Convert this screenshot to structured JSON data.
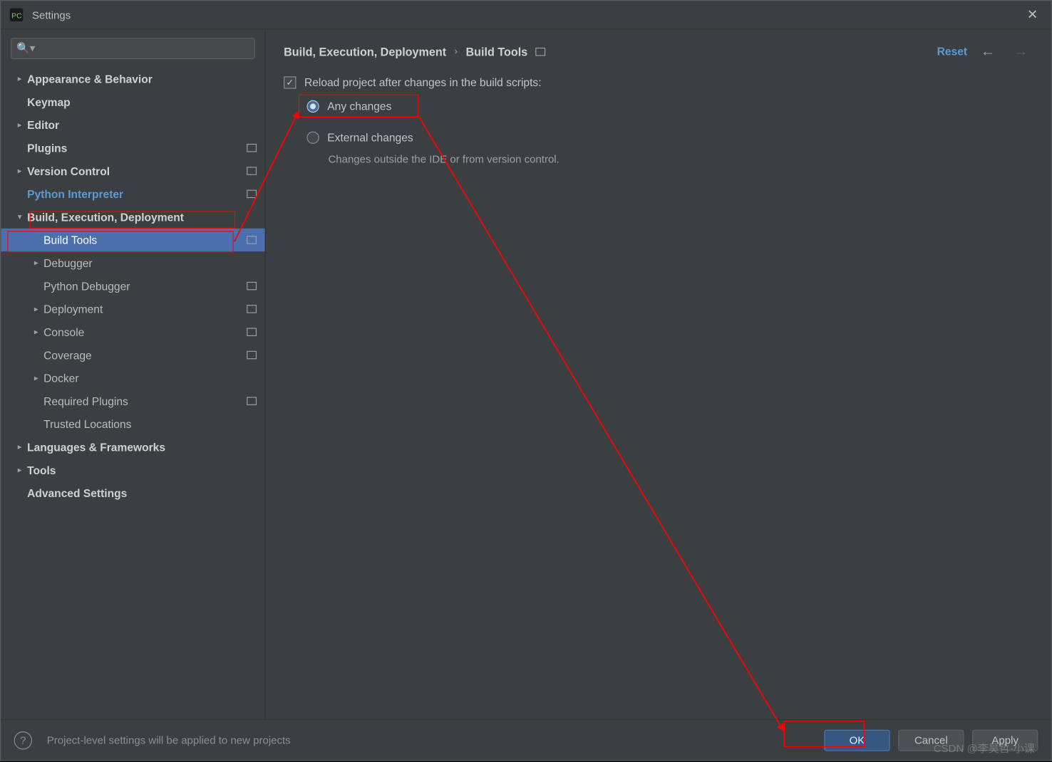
{
  "titlebar": {
    "title": "Settings"
  },
  "sidebar": {
    "search_placeholder": "",
    "items": [
      {
        "label": "Appearance & Behavior",
        "arrow": "right",
        "indent": 1,
        "bold": true
      },
      {
        "label": "Keymap",
        "arrow": "none",
        "indent": 1,
        "bold": true
      },
      {
        "label": "Editor",
        "arrow": "right",
        "indent": 1,
        "bold": true
      },
      {
        "label": "Plugins",
        "arrow": "none",
        "indent": 1,
        "bold": true,
        "proj": true
      },
      {
        "label": "Version Control",
        "arrow": "right",
        "indent": 1,
        "bold": true,
        "proj": true
      },
      {
        "label": "Python Interpreter",
        "arrow": "none",
        "indent": 1,
        "bold": true,
        "accent": true,
        "proj": true
      },
      {
        "label": "Build, Execution, Deployment",
        "arrow": "down",
        "indent": 1,
        "bold": true
      },
      {
        "label": "Build Tools",
        "arrow": "none",
        "indent": 2,
        "selected": true,
        "proj": true
      },
      {
        "label": "Debugger",
        "arrow": "right",
        "indent": 2
      },
      {
        "label": "Python Debugger",
        "arrow": "none",
        "indent": 2,
        "proj": true
      },
      {
        "label": "Deployment",
        "arrow": "right",
        "indent": 2,
        "proj": true
      },
      {
        "label": "Console",
        "arrow": "right",
        "indent": 2,
        "proj": true
      },
      {
        "label": "Coverage",
        "arrow": "none",
        "indent": 2,
        "proj": true
      },
      {
        "label": "Docker",
        "arrow": "right",
        "indent": 2
      },
      {
        "label": "Required Plugins",
        "arrow": "none",
        "indent": 2,
        "proj": true
      },
      {
        "label": "Trusted Locations",
        "arrow": "none",
        "indent": 2
      },
      {
        "label": "Languages & Frameworks",
        "arrow": "right",
        "indent": 1,
        "bold": true
      },
      {
        "label": "Tools",
        "arrow": "right",
        "indent": 1,
        "bold": true
      },
      {
        "label": "Advanced Settings",
        "arrow": "none",
        "indent": 1,
        "bold": true
      }
    ]
  },
  "content": {
    "breadcrumb_root": "Build, Execution, Deployment",
    "breadcrumb_leaf": "Build Tools",
    "reset": "Reset",
    "checkbox_label": "Reload project after changes in the build scripts:",
    "checkbox_checked": true,
    "radio_any": "Any changes",
    "radio_external": "External changes",
    "radio_selected": "any",
    "hint": "Changes outside the IDE or from version control."
  },
  "footer": {
    "message": "Project-level settings will be applied to new projects",
    "ok": "OK",
    "cancel": "Cancel",
    "apply": "Apply"
  },
  "watermark": "CSDN @李昊哲-小课"
}
